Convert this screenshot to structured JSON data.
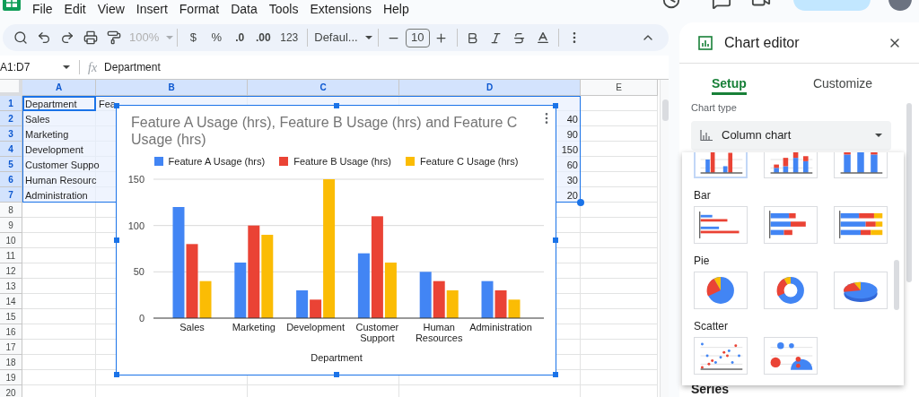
{
  "menu": [
    "File",
    "Edit",
    "View",
    "Insert",
    "Format",
    "Data",
    "Tools",
    "Extensions",
    "Help"
  ],
  "toolbar": {
    "zoom": {
      "label": "100%",
      "disabled": true
    },
    "currency": "$",
    "percent": "%",
    "decimal_decrease": ".0",
    "decimal_increase": ".00",
    "number_format": "123",
    "font": "Defaul...",
    "font_size": "10"
  },
  "formula_bar": {
    "name_box": "A1:D7",
    "fx": "fx",
    "formula": "Department"
  },
  "sheet": {
    "columns": [
      {
        "label": "A",
        "selected": true
      },
      {
        "label": "B",
        "selected": true
      },
      {
        "label": "C",
        "selected": true
      },
      {
        "label": "D",
        "selected": true
      },
      {
        "label": "E",
        "selected": false
      }
    ],
    "rows": [
      {
        "number": "1",
        "selected": true,
        "a": "Department",
        "b": "Fea"
      },
      {
        "number": "2",
        "selected": true,
        "a": "Sales",
        "d": "40"
      },
      {
        "number": "3",
        "selected": true,
        "a": "Marketing",
        "d": "90"
      },
      {
        "number": "4",
        "selected": true,
        "a": "Development",
        "d": "150"
      },
      {
        "number": "5",
        "selected": true,
        "a": "Customer Suppo",
        "d": "60"
      },
      {
        "number": "6",
        "selected": true,
        "a": "Human Resourc",
        "d": "30"
      },
      {
        "number": "7",
        "selected": true,
        "a": "Administration",
        "d": "20"
      },
      {
        "number": "8",
        "selected": false
      },
      {
        "number": "9",
        "selected": false
      },
      {
        "number": "10",
        "selected": false
      },
      {
        "number": "11",
        "selected": false
      },
      {
        "number": "12",
        "selected": false
      },
      {
        "number": "13",
        "selected": false
      },
      {
        "number": "14",
        "selected": false
      },
      {
        "number": "15",
        "selected": false
      },
      {
        "number": "16",
        "selected": false
      },
      {
        "number": "17",
        "selected": false
      },
      {
        "number": "18",
        "selected": false
      },
      {
        "number": "19",
        "selected": false
      },
      {
        "number": "20",
        "selected": false
      }
    ]
  },
  "chart": {
    "selected": true,
    "chart_data": {
      "type": "bar",
      "title": "Feature A Usage (hrs), Feature B Usage (hrs) and Feature C Usage (hrs)",
      "xlabel": "Department",
      "categories": [
        "Sales",
        "Marketing",
        "Development",
        "Customer Support",
        "Human Resources",
        "Administration"
      ],
      "series": [
        {
          "name": "Feature A Usage (hrs)",
          "color": "#4285f4",
          "values": [
            120,
            60,
            30,
            70,
            50,
            40
          ]
        },
        {
          "name": "Feature B Usage (hrs)",
          "color": "#ea4335",
          "values": [
            80,
            100,
            20,
            110,
            40,
            30
          ]
        },
        {
          "name": "Feature C Usage (hrs)",
          "color": "#fbbc04",
          "values": [
            40,
            90,
            150,
            60,
            30,
            20
          ]
        }
      ],
      "ylim": [
        0,
        150
      ],
      "yticks": [
        0,
        50,
        100,
        150
      ],
      "legend": "top"
    }
  },
  "chart_editor": {
    "title": "Chart editor",
    "tabs": [
      {
        "label": "Setup",
        "selected": true
      },
      {
        "label": "Customize",
        "selected": false
      }
    ],
    "chart_type_label": "Chart type",
    "chart_type": "Column chart",
    "chart_type_sections": [
      {
        "options": [
          {
            "kind": "column",
            "selected": true
          },
          {
            "kind": "stacked_column",
            "selected": false
          },
          {
            "kind": "percent_column",
            "selected": false
          }
        ]
      },
      {
        "label": "Bar",
        "options": [
          {
            "kind": "bar",
            "selected": false
          },
          {
            "kind": "stacked_bar",
            "selected": false
          },
          {
            "kind": "percent_bar",
            "selected": false
          }
        ]
      },
      {
        "label": "Pie",
        "options": [
          {
            "kind": "pie",
            "selected": false
          },
          {
            "kind": "donut",
            "selected": false
          },
          {
            "kind": "pie_3d",
            "selected": false
          }
        ]
      },
      {
        "label": "Scatter",
        "options": [
          {
            "kind": "scatter",
            "selected": false
          },
          {
            "kind": "bubble",
            "selected": false
          }
        ]
      }
    ],
    "next_section": "Series"
  }
}
